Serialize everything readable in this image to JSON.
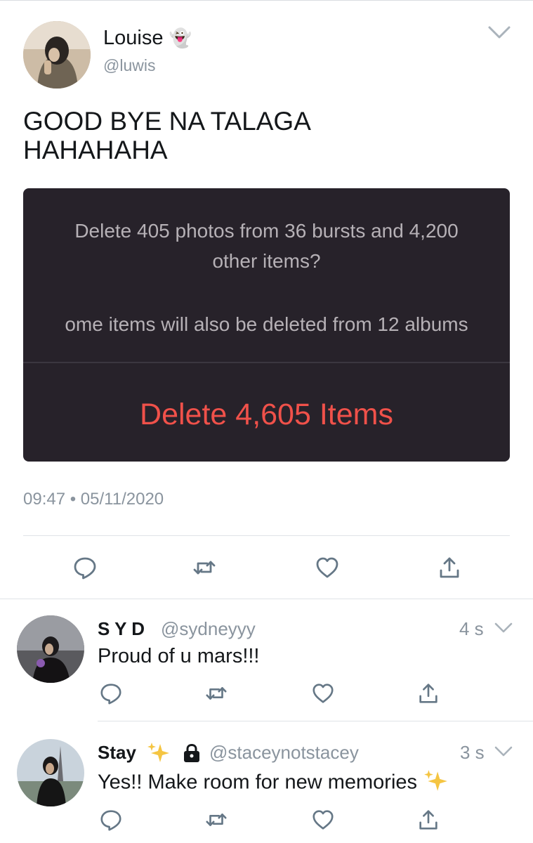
{
  "main_tweet": {
    "author_name": "Louise",
    "author_emoji": "👻",
    "handle": "@luwis",
    "text_line1": "GOOD BYE NA TALAGA",
    "text_line2": "HAHAHAHA",
    "media": {
      "line1": "Delete 405 photos from 36 bursts and 4,200",
      "line2": "other items?",
      "line3": "ome items will also be deleted from 12 albums",
      "button": "Delete 4,605 Items"
    },
    "timestamp": "09:47 • 05/11/2020"
  },
  "replies": [
    {
      "name": "S Y D",
      "handle": "@sydneyyy",
      "time": "4 s",
      "text": "Proud of u mars!!!"
    },
    {
      "name": "Stay",
      "handle": "@staceynotstacey",
      "time": "3 s",
      "text": "Yes!! Make room for new memories",
      "private": true
    }
  ],
  "icons": {
    "reply": "reply-icon",
    "retweet": "retweet-icon",
    "like": "like-icon",
    "share": "share-icon",
    "caret": "chevron-down-icon",
    "lock": "lock-icon",
    "sparkles": "sparkles-icon"
  },
  "colors": {
    "text": "#14171a",
    "secondary": "#8a949e",
    "icon": "#657786",
    "delete_red": "#f0514a",
    "media_bg": "#27222a",
    "sparkle": "#f5c542"
  }
}
